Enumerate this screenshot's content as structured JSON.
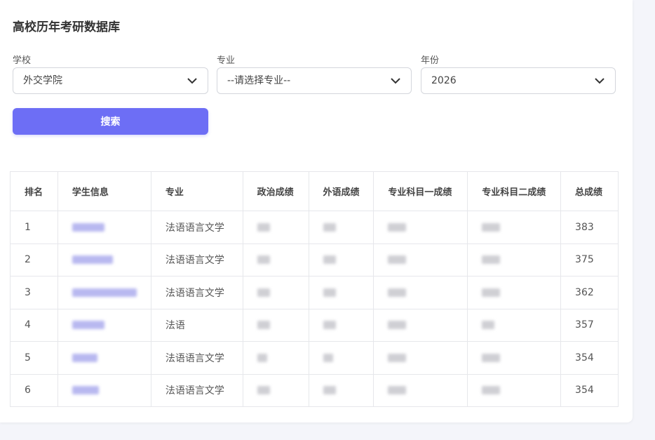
{
  "page": {
    "title": "高校历年考研数据库"
  },
  "filters": {
    "school": {
      "label": "学校",
      "value": "外交学院"
    },
    "major": {
      "label": "专业",
      "value": "--请选择专业--"
    },
    "year": {
      "label": "年份",
      "value": "2026"
    }
  },
  "search_button": {
    "label": "搜索"
  },
  "table": {
    "headers": [
      "排名",
      "学生信息",
      "专业",
      "政治成绩",
      "外语成绩",
      "专业科目一成绩",
      "专业科目二成绩",
      "总成绩"
    ],
    "rows": [
      {
        "rank": "1",
        "major": "法语语言文学",
        "total": "383"
      },
      {
        "rank": "2",
        "major": "法语语言文学",
        "total": "375"
      },
      {
        "rank": "3",
        "major": "法语语言文学",
        "total": "362"
      },
      {
        "rank": "4",
        "major": "法语",
        "total": "357"
      },
      {
        "rank": "5",
        "major": "法语语言文学",
        "total": "354"
      },
      {
        "rank": "6",
        "major": "法语语言文学",
        "total": "354"
      }
    ]
  },
  "colors": {
    "accent": "#6d6ef5",
    "border": "#e6e7eb"
  },
  "icons": {
    "dropdown": "chevron-down-icon"
  }
}
